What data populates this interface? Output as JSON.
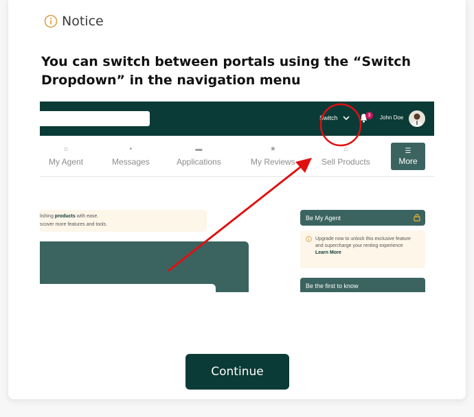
{
  "modal": {
    "notice_title": "Notice",
    "heading": "You can switch between portals using the “Switch Dropdown” in the navigation menu",
    "continue_label": "Continue"
  },
  "screenshot": {
    "topbar": {
      "switch_label": "Switch",
      "notification_count": "3",
      "user_name": "John Doe"
    },
    "nav": {
      "items": [
        {
          "label": "My Agent",
          "icon": "agent-icon"
        },
        {
          "label": "Messages",
          "icon": "message-icon"
        },
        {
          "label": "Applications",
          "icon": "applications-icon"
        },
        {
          "label": "My Reviews",
          "icon": "star-icon"
        },
        {
          "label": "Sell Products",
          "icon": "lock-icon"
        },
        {
          "label": "More",
          "icon": "menu-icon"
        }
      ]
    },
    "promo": {
      "line1_prefix": "lishing ",
      "line1_bold": "products",
      "line1_suffix": " with ease.",
      "line2": "scover more features and tools."
    },
    "agent_card": {
      "title": "Be My Agent",
      "text": "Upgrade now to unlock this  exclusive feature  and supercharge your renting experience",
      "link": "Learn More"
    },
    "first_card": {
      "title": "Be the first to know"
    }
  },
  "colors": {
    "brand_dark": "#0b3b36",
    "brand_mid": "#3b6461",
    "accent_warning": "#d8a24a",
    "annotation_red": "#e01010",
    "badge": "#c2185b"
  }
}
